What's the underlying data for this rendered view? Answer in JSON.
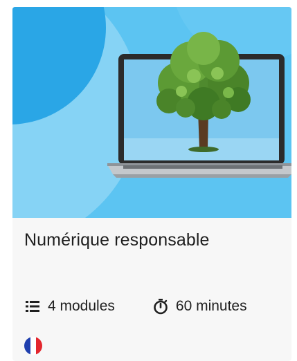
{
  "course": {
    "title": "Numérique responsable",
    "image_icon": "laptop-with-tree-illustration",
    "modules_icon": "list-icon",
    "modules_label": "4 modules",
    "duration_icon": "stopwatch-icon",
    "duration_label": "60 minutes",
    "language_icon": "french-flag-icon"
  },
  "colors": {
    "hero_background": "#5cc4f2",
    "hero_circle_dark": "#2aa6e6",
    "hero_circle_light": "#86d3f5",
    "flag_blue": "#1f3fae",
    "flag_white": "#ffffff",
    "flag_red": "#e3262d",
    "text": "#1f1f1f"
  }
}
